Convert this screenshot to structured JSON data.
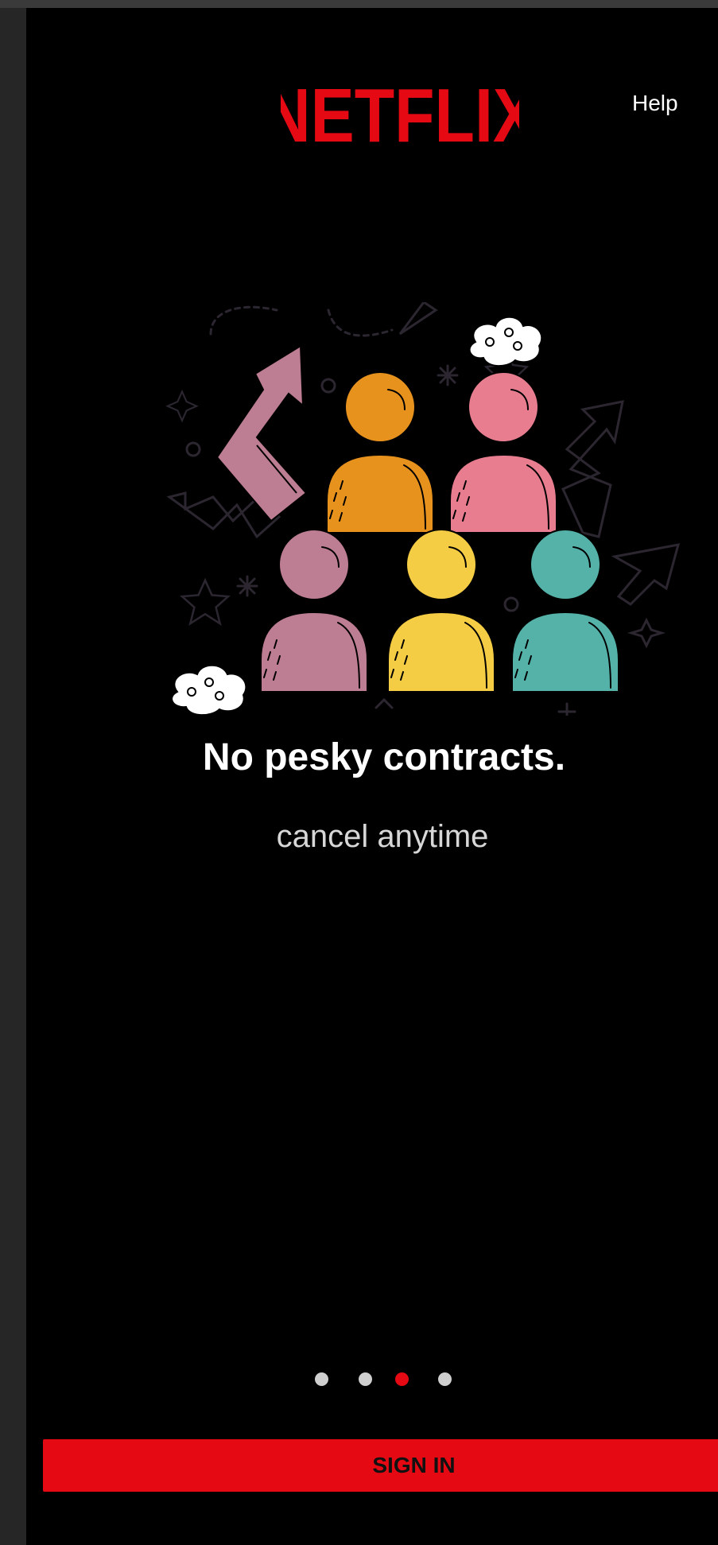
{
  "header": {
    "logo_text": "NETFLIX",
    "help_label": "Help"
  },
  "onboarding": {
    "illustration_name": "group-of-people-illustration",
    "headline": "No pesky contracts.",
    "subline": "cancel anytime",
    "pager": {
      "total": 4,
      "active_index": 2
    }
  },
  "actions": {
    "sign_in_label": "SIGN IN"
  },
  "colors": {
    "brand_red": "#e50914",
    "background": "#000000",
    "dot_inactive": "#cfcfcf",
    "person_orange": "#e8921e",
    "person_pink": "#e77d8f",
    "person_mauve": "#bd7d92",
    "person_yellow": "#f4cd45",
    "person_teal": "#54b2a9"
  }
}
